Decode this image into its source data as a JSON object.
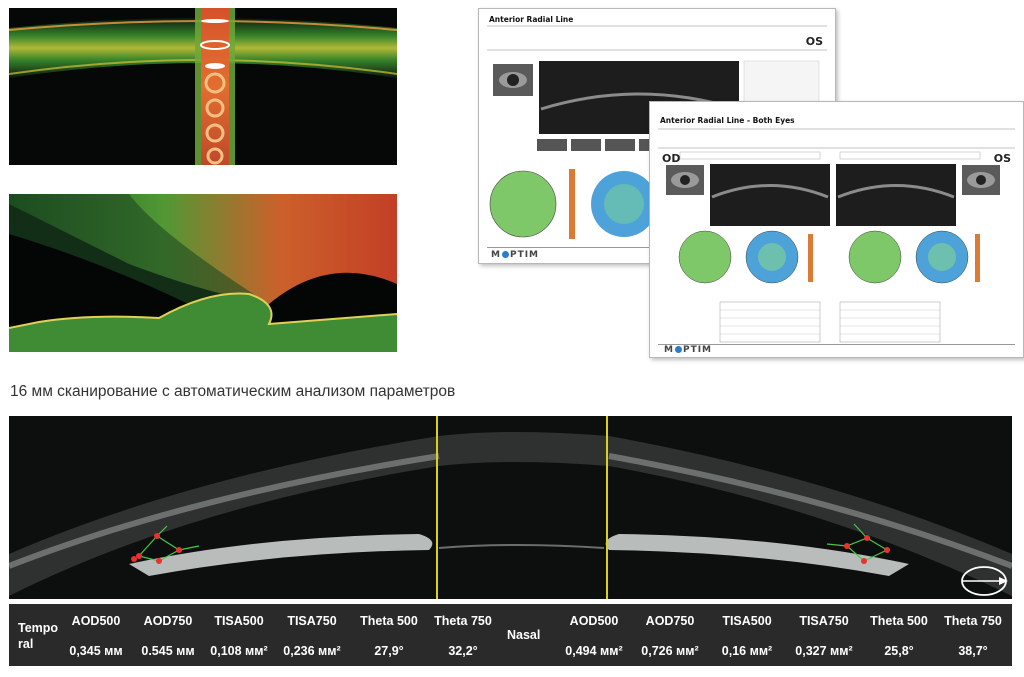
{
  "caption": "16 мм сканирование с автоматическим анализом параметров",
  "report1": {
    "title": "Anterior Radial Line",
    "eye": "OS",
    "logo_left": "M",
    "logo_right": "PTIM"
  },
  "report2": {
    "title": "Anterior Radial Line - Both Eyes",
    "eye_left": "OD",
    "eye_right": "OS",
    "logo_left": "M",
    "logo_right": "PTIM"
  },
  "table": {
    "temporal_label": "Tempo ral",
    "nasal_label": "Nasal",
    "temporal_headers": [
      "AOD500",
      "AOD750",
      "TISA500",
      "TISA750",
      "Theta 500",
      "Theta 750"
    ],
    "temporal_values": [
      "0,345 мм",
      "0.545 мм",
      "0,108 мм²",
      "0,236 мм²",
      "27,9°",
      "32,2°"
    ],
    "nasal_headers": [
      "AOD500",
      "AOD750",
      "TISA500",
      "TISA750",
      "Theta 500",
      "Theta 750"
    ],
    "nasal_values": [
      "0,494 мм²",
      "0,726 мм²",
      "0,16 мм²",
      "0,327 мм²",
      "25,8°",
      "38,7°"
    ]
  },
  "colors": {
    "table_bg": "#2a2a2a",
    "scan_bg": "#0c0f0e",
    "marker_line": "#d8d21c",
    "angle_points": "#e8322e",
    "angle_lines": "#48c84a"
  },
  "icons": [
    "eye-direction-icon"
  ]
}
